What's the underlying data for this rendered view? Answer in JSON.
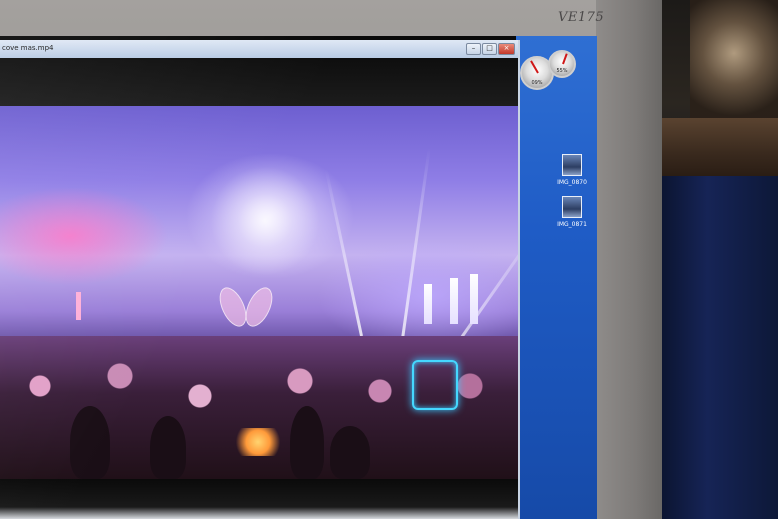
{
  "monitor": {
    "brand": "VE175"
  },
  "player": {
    "title": "cove mas.mp4",
    "minimize_label": "–",
    "maximize_label": "□",
    "close_label": "×"
  },
  "desktop": {
    "gadget_cpu_label": "09%",
    "gadget_mem_label": "55%",
    "icons": [
      {
        "label": "IMG_0870",
        "icon": "image-file-icon"
      },
      {
        "label": "IMG_0871",
        "icon": "image-file-icon"
      }
    ]
  },
  "colors": {
    "desktop_blue": "#1f5cc6",
    "stage_purple": "#8f7ee6",
    "crowd_pink": "#e2a0c8",
    "vest_glow": "#45d8ff"
  }
}
